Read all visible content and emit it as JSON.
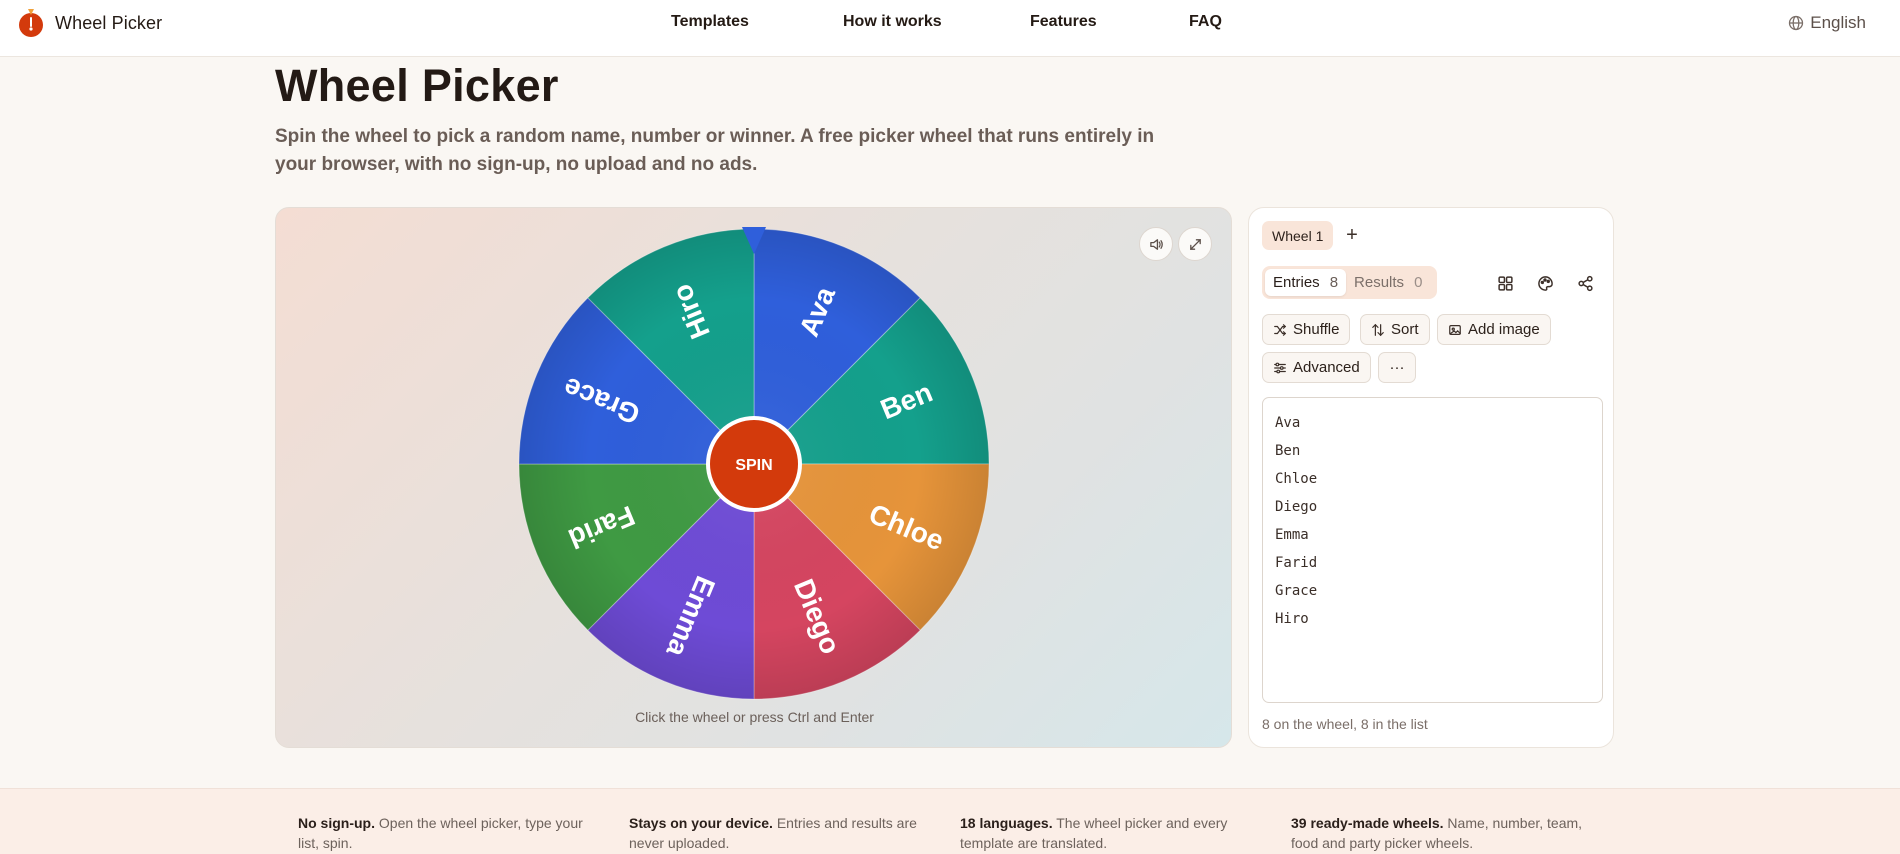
{
  "header": {
    "brand": "Wheel Picker",
    "nav": [
      "Templates",
      "How it works",
      "Features",
      "FAQ"
    ],
    "language": "English"
  },
  "hero": {
    "title": "Wheel Picker",
    "description": "Spin the wheel to pick a random name, number or winner. A free picker wheel that runs entirely in your browser, with no sign-up, no upload and no ads."
  },
  "wheel": {
    "spin_label": "SPIN",
    "hint": "Click the wheel or press Ctrl and Enter",
    "segments": [
      {
        "label": "Ava",
        "color": "#2f5fdb"
      },
      {
        "label": "Ben",
        "color": "#14a08c"
      },
      {
        "label": "Chloe",
        "color": "#e6943a"
      },
      {
        "label": "Diego",
        "color": "#d54560"
      },
      {
        "label": "Emma",
        "color": "#6e4bd6"
      },
      {
        "label": "Farid",
        "color": "#3f9a43"
      },
      {
        "label": "Grace",
        "color": "#2f5fdb"
      },
      {
        "label": "Hiro",
        "color": "#14a08c"
      }
    ],
    "pointer_color": "#2f5fdb",
    "spin_color": "#d33a0c"
  },
  "sidebar": {
    "wheel_tab": "Wheel 1",
    "add_tab": "+",
    "entries_label": "Entries",
    "entries_count": "8",
    "results_label": "Results",
    "results_count": "0",
    "tools": {
      "shuffle": "Shuffle",
      "sort": "Sort",
      "add_image": "Add image",
      "advanced": "Advanced",
      "more": "···"
    },
    "entries": [
      "Ava",
      "Ben",
      "Chloe",
      "Diego",
      "Emma",
      "Farid",
      "Grace",
      "Hiro"
    ],
    "footer": "8 on the wheel, 8 in the list"
  },
  "features": [
    {
      "title": "No sign-up.",
      "text": "Open the wheel picker, type your list, spin."
    },
    {
      "title": "Stays on your device.",
      "text": "Entries and results are never uploaded."
    },
    {
      "title": "18 languages.",
      "text": "The wheel picker and every template are translated."
    },
    {
      "title": "39 ready-made wheels.",
      "text": "Name, number, team, food and party picker wheels."
    }
  ],
  "colors": {
    "accent": "#d33a0c",
    "page_bg": "#faf7f3",
    "soft_accent": "#f9e5d9"
  }
}
